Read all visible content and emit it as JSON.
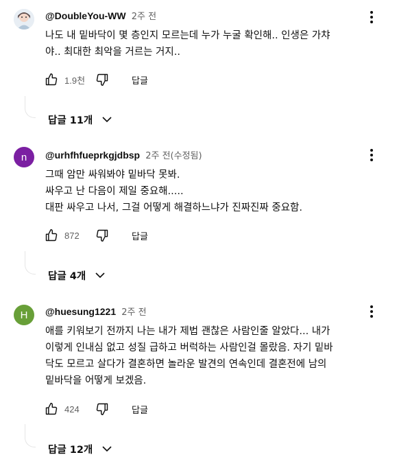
{
  "comments": [
    {
      "author": "@DoubleYou-WW",
      "time": "2주 전",
      "avatar_letter": "",
      "avatar_color": "#c8d8e4",
      "lines": [
        "나도 내 밑바닥이 몇 층인지 모르는데 누가 누굴 확인해.. 인생은 가챠",
        "야.. 최대한 최악을 거르는 거지.."
      ],
      "likes": "1.9천",
      "reply_label": "답글",
      "replies_label": "답글 11개"
    },
    {
      "author": "@urhfhfueprkgjdbsp",
      "time": "2주 전(수정됨)",
      "avatar_letter": "n",
      "avatar_color": "#7b1fa2",
      "lines": [
        "그때 암만 싸워봐야 밑바닥 못봐.",
        "싸우고 난 다음이 제일 중요해.....",
        "대판 싸우고 나서, 그걸 어떻게 해결하느냐가 진짜진짜 중요함."
      ],
      "likes": "872",
      "reply_label": "답글",
      "replies_label": "답글 4개"
    },
    {
      "author": "@huesung1221",
      "time": "2주 전",
      "avatar_letter": "H",
      "avatar_color": "#689f38",
      "lines": [
        "애를 키워보기 전까지 나는 내가 제법 괜찮은 사람인줄 알았다... 내가",
        "이렇게 인내심 없고 성질 급하고 버럭하는 사람인걸 몰랐음. 자기 밑바",
        "닥도 모르고 살다가 결혼하면 놀라운 발견의 연속인데 결혼전에 남의",
        "밑바닥을 어떻게 보겠음."
      ],
      "likes": "424",
      "reply_label": "답글",
      "replies_label": "답글 12개"
    }
  ]
}
